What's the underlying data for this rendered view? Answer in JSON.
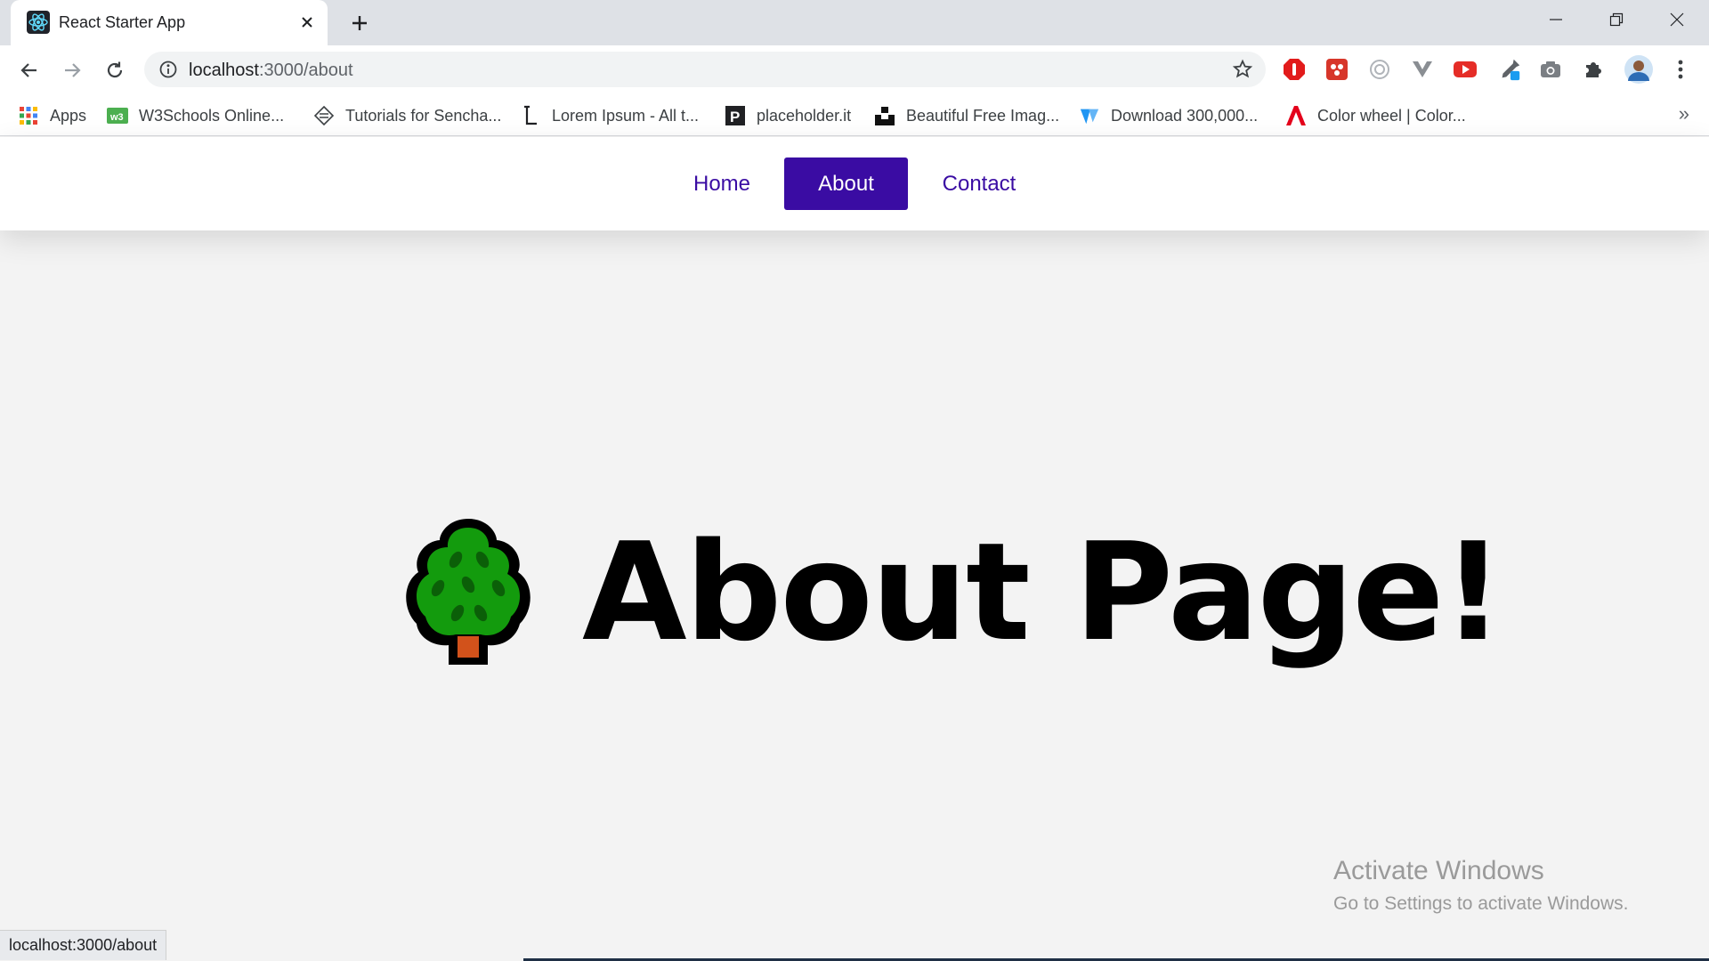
{
  "browser": {
    "tab_title": "React Starter App",
    "url_host": "localhost",
    "url_path": ":3000/about",
    "icons": {
      "tab_favicon": "react-icon",
      "tab_close": "close-icon",
      "new_tab": "plus-icon",
      "minimize": "minimize-icon",
      "restore": "restore-icon",
      "close_window": "close-icon",
      "back": "arrow-left-icon",
      "forward": "arrow-right-icon",
      "reload": "reload-icon",
      "site_info": "info-icon",
      "bookmark_star": "star-icon",
      "menu": "kebab-icon"
    },
    "extensions": [
      "adblock-icon",
      "extension-red-icon",
      "target-icon",
      "vpn-icon",
      "youtube-icon",
      "eyedropper-icon",
      "camera-icon",
      "puzzle-icon",
      "avatar"
    ]
  },
  "bookmarks": {
    "items": [
      {
        "label": "Apps",
        "icon": "apps-grid-icon"
      },
      {
        "label": "W3Schools Online...",
        "icon": "w3schools-icon"
      },
      {
        "label": "Tutorials for Sencha...",
        "icon": "sencha-icon"
      },
      {
        "label": "Lorem Ipsum - All t...",
        "icon": "lorem-icon"
      },
      {
        "label": "placeholder.it",
        "icon": "placeholder-icon"
      },
      {
        "label": "Beautiful Free Imag...",
        "icon": "unsplash-icon"
      },
      {
        "label": "Download 300,000...",
        "icon": "download-site-icon"
      },
      {
        "label": "Color wheel | Color...",
        "icon": "adobe-icon"
      }
    ],
    "more": "»"
  },
  "page": {
    "nav": [
      {
        "label": "Home",
        "active": false
      },
      {
        "label": "About",
        "active": true
      },
      {
        "label": "Contact",
        "active": false
      }
    ],
    "heading": "About Page!",
    "heading_icon": "tree-icon",
    "colors": {
      "accent": "#3a0ca3",
      "background": "#f3f3f3"
    }
  },
  "watermark": {
    "title": "Activate Windows",
    "subtitle": "Go to Settings to activate Windows."
  },
  "status": "localhost:3000/about"
}
